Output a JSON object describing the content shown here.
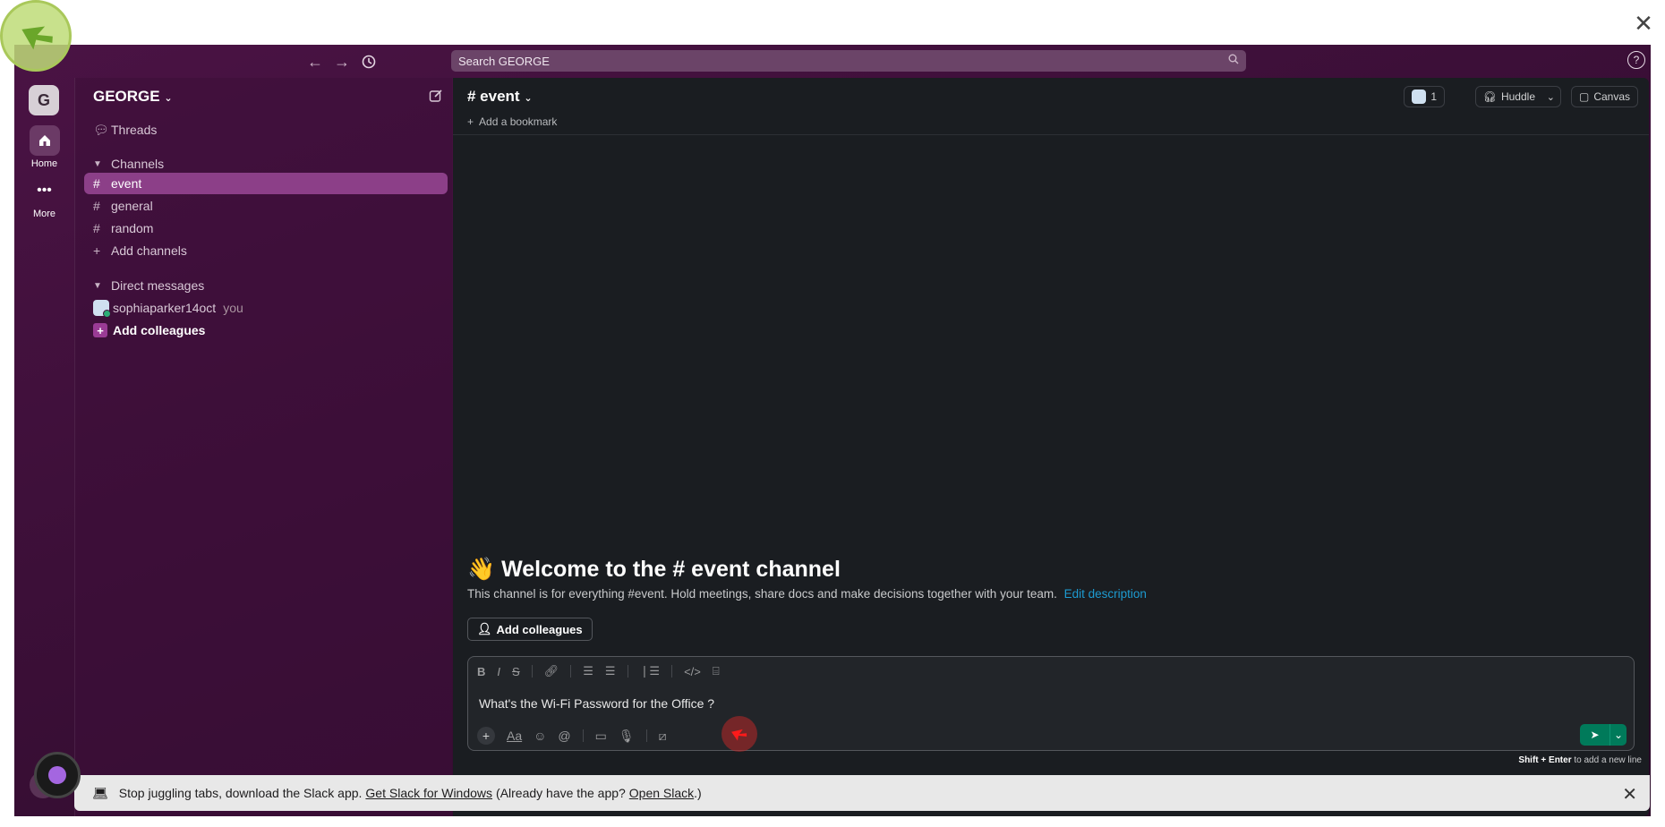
{
  "page": {
    "close_glyph": "✕"
  },
  "topbar": {
    "search_placeholder": "Search GEORGE",
    "help_glyph": "?"
  },
  "rail": {
    "workspace_initial": "G",
    "home_label": "Home",
    "more_label": "More",
    "plus_glyph": "+"
  },
  "sidebar": {
    "workspace_name": "GEORGE",
    "threads": "Threads",
    "channels_header": "Channels",
    "channels": [
      "event",
      "general",
      "random"
    ],
    "add_channels": "Add channels",
    "dm_header": "Direct messages",
    "dm_user": "sophiaparker14oct",
    "dm_you": "you",
    "add_colleagues": "Add colleagues"
  },
  "channel": {
    "title": "# event",
    "add_bookmark": "Add a bookmark",
    "member_count": "1",
    "huddle": "Huddle",
    "canvas": "Canvas",
    "welcome_emoji": "👋",
    "welcome": "Welcome to the # event channel",
    "description": "This channel is for everything #event. Hold meetings, share docs and make decisions together with your team.",
    "edit_description": "Edit description",
    "add_colleagues_btn": "Add colleagues"
  },
  "composer": {
    "message": "What's the Wi-Fi Password for the Office ?",
    "hint_keys": "Shift + Enter",
    "hint_text": "to add a new line"
  },
  "banner": {
    "text_before": "Stop juggling tabs, download the Slack app.",
    "link1": "Get Slack for Windows",
    "text_mid": "(Already have the app?",
    "link2": "Open Slack",
    "text_end": ".)",
    "close_glyph": "✕"
  },
  "colors": {
    "accent": "#8c3f88",
    "sidebar_bg": "#3c0f38",
    "main_bg": "#1a1d21",
    "send": "#007a5a",
    "link": "#1d9bd1"
  }
}
